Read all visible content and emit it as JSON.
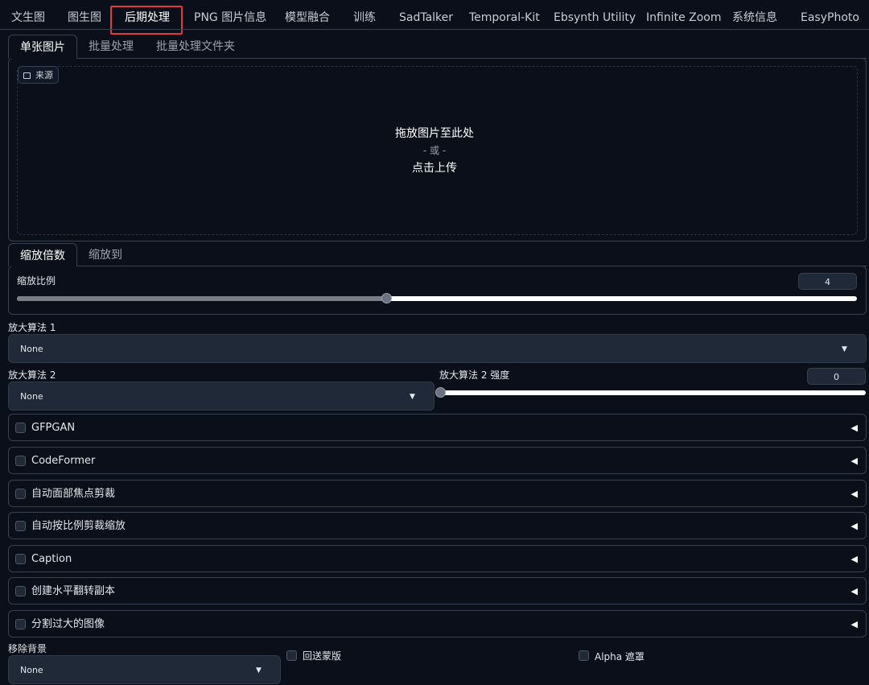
{
  "top_tabs": [
    {
      "label": "文生图",
      "active": false
    },
    {
      "label": "图生图",
      "active": false
    },
    {
      "label": "后期处理",
      "active": true
    },
    {
      "label": "PNG 图片信息",
      "active": false
    },
    {
      "label": "模型融合",
      "active": false
    },
    {
      "label": "训练",
      "active": false
    },
    {
      "label": "SadTalker",
      "active": false
    },
    {
      "label": "Temporal-Kit",
      "active": false
    },
    {
      "label": "Ebsynth Utility",
      "active": false
    },
    {
      "label": "Infinite Zoom",
      "active": false
    },
    {
      "label": "系统信息",
      "active": false
    },
    {
      "label": "EasyPhoto",
      "active": false
    }
  ],
  "sub_tabs": [
    {
      "label": "单张图片",
      "active": true
    },
    {
      "label": "批量处理",
      "active": false
    },
    {
      "label": "批量处理文件夹",
      "active": false
    }
  ],
  "upload": {
    "source_label": "来源",
    "line1": "拖放图片至此处",
    "line2": "- 或 -",
    "line3": "点击上传"
  },
  "scale_tabs": [
    {
      "label": "缩放倍数",
      "active": true
    },
    {
      "label": "缩放到",
      "active": false
    }
  ],
  "scale": {
    "label": "缩放比例",
    "value": "4",
    "fraction": 0.44
  },
  "upscaler1": {
    "label": "放大算法 1",
    "value": "None"
  },
  "upscaler2": {
    "label": "放大算法 2",
    "value": "None"
  },
  "upscaler2_strength": {
    "label": "放大算法 2 强度",
    "value": "0",
    "fraction": 0.0
  },
  "accordions": [
    {
      "label": "GFPGAN"
    },
    {
      "label": "CodeFormer"
    },
    {
      "label": "自动面部焦点剪裁"
    },
    {
      "label": "自动按比例剪裁缩放"
    },
    {
      "label": "Caption"
    },
    {
      "label": "创建水平翻转副本"
    },
    {
      "label": "分割过大的图像"
    }
  ],
  "remove_bg": {
    "label": "移除背景",
    "value": "None",
    "return_mask_label": "回送蒙版",
    "alpha_matting_label": "Alpha 遮罩"
  },
  "colors": {
    "background": "#0b0f19",
    "active_tab_outline": "#e53935"
  }
}
